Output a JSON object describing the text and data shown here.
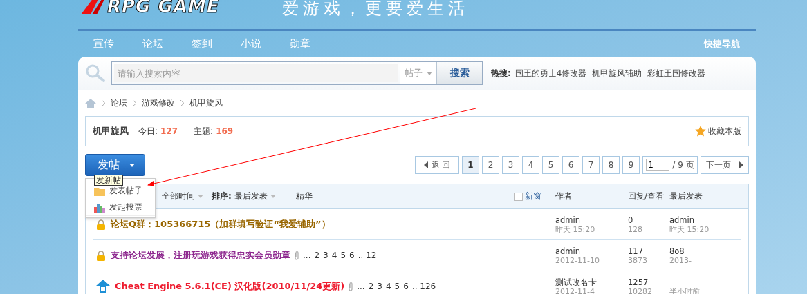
{
  "header": {
    "logo": "RPG GAME",
    "slogan": "爱游戏，更要爱生活"
  },
  "nav": {
    "items": [
      {
        "label": "宣传"
      },
      {
        "label": "论坛"
      },
      {
        "label": "签到"
      },
      {
        "label": "小说"
      },
      {
        "label": "勋章"
      }
    ],
    "quick_nav": "快捷导航"
  },
  "search": {
    "placeholder": "请输入搜索内容",
    "scope": "帖子",
    "button": "搜索",
    "hot_label": "热搜:",
    "hot": [
      "国王的勇士4修改器",
      "机甲旋风辅助",
      "彩虹王国修改器"
    ]
  },
  "breadcrumb": [
    "论坛",
    "游戏修改",
    "机甲旋风"
  ],
  "forum": {
    "name": "机甲旋风",
    "today_label": "今日:",
    "today": "127",
    "threads_label": "主题:",
    "threads": "169",
    "favorite": "收藏本版"
  },
  "post_button": {
    "label": "发帖"
  },
  "post_menu": {
    "tooltip": "发新帖",
    "items": [
      {
        "kind": "folder",
        "label": "发表帖子"
      },
      {
        "kind": "chart",
        "label": "发起投票"
      }
    ]
  },
  "pagination": {
    "back": "返 回",
    "pages": [
      {
        "label": "1",
        "selected": true
      },
      {
        "label": "2",
        "selected": false
      },
      {
        "label": "3",
        "selected": false
      },
      {
        "label": "4",
        "selected": false
      },
      {
        "label": "5",
        "selected": false
      },
      {
        "label": "6",
        "selected": false
      },
      {
        "label": "7",
        "selected": false
      },
      {
        "label": "8",
        "selected": false
      },
      {
        "label": "9",
        "selected": false
      }
    ],
    "jump_value": "1",
    "total": "/ 9 页",
    "next": "下一页"
  },
  "filters": [
    {
      "label": "全部时间",
      "dropdown": true
    },
    {
      "label": "**排序:** 最后发表",
      "dropdown": true
    },
    {
      "label": "精华",
      "dropdown": false
    }
  ],
  "new_window": {
    "label": "新窗",
    "checked": false
  },
  "columns": [
    "作者",
    "回复/查看",
    "最后发表"
  ],
  "threads": [
    {
      "kind": "lock",
      "title": "论坛Q群：105366715（加群填写验证“我爱辅助”）",
      "color": "#996600",
      "attachment": false,
      "author": "admin",
      "date": "昨天 15:20",
      "replies": "0",
      "views": "128",
      "last_poster": "admin",
      "last_time": "昨天 15:20"
    },
    {
      "kind": "lock",
      "title": "支持论坛发展，注册玩游戏获得忠实会员勋章",
      "color": "#8f2a90",
      "attachment": true,
      "pages": [
        "...",
        "2",
        "3",
        "4",
        "5",
        "6",
        ".. 12"
      ],
      "author": "admin",
      "date": "2012-11-10",
      "replies": "117",
      "views": "3873",
      "last_poster": "8o8",
      "last_time": "2013-"
    },
    {
      "kind": "up",
      "title": "Cheat Engine 5.6.1(CE) 汉化版(2010/11/24更新)",
      "color": "#ee1b2e",
      "attachment": true,
      "pages": [
        "...",
        "2",
        "3",
        "4",
        "5",
        "6",
        ".. 126"
      ],
      "author": "测试改名卡",
      "date": "2012-11-4",
      "replies": "1257",
      "views": "10282",
      "last_time": "半小时前"
    }
  ]
}
